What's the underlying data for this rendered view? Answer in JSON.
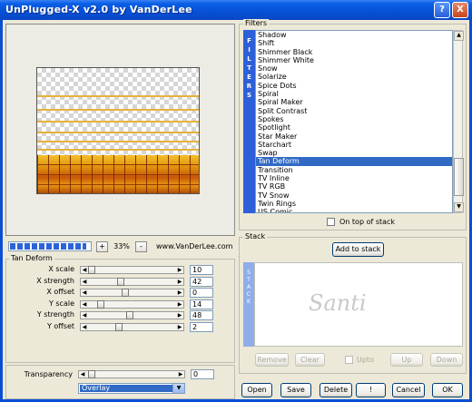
{
  "window": {
    "title": "UnPlugged-X v2.0 by VanDerLee",
    "help_label": "?",
    "close_label": "X"
  },
  "preview": {
    "zoom_value": "33%",
    "zoom_plus": "+",
    "zoom_minus": "-",
    "website": "www.VanDerLee.com",
    "progress_fraction": 0.95
  },
  "tan_deform": {
    "title": "Tan Deform",
    "sliders": [
      {
        "label": "X scale",
        "value": "10"
      },
      {
        "label": "X strength",
        "value": "42"
      },
      {
        "label": "X offset",
        "value": "0"
      },
      {
        "label": "Y scale",
        "value": "14"
      },
      {
        "label": "Y strength",
        "value": "48"
      },
      {
        "label": "Y offset",
        "value": "2"
      }
    ]
  },
  "transparency": {
    "label": "Transparency",
    "value": "0",
    "blend_mode": "Overlay"
  },
  "filters": {
    "title": "Filters",
    "strip_letters": [
      "F",
      "I",
      "L",
      "T",
      "E",
      "R",
      "S"
    ],
    "items": [
      "Shadow",
      "Shift",
      "Shimmer Black",
      "Shimmer White",
      "Snow",
      "Solarize",
      "Spice Dots",
      "Spiral",
      "Spiral Maker",
      "Split Contrast",
      "Spokes",
      "Spotlight",
      "Star Maker",
      "Starchart",
      "Swap",
      "Tan Deform",
      "Transition",
      "TV Inline",
      "TV RGB",
      "TV Snow",
      "Twin Rings",
      "US Comic"
    ],
    "selected_index": 15,
    "on_top_label": "On top of stack"
  },
  "stack": {
    "title": "Stack",
    "add_label": "Add to stack",
    "strip_letters": [
      "S",
      "T",
      "A",
      "C",
      "K"
    ],
    "watermark": "Santi",
    "remove_label": "Remove",
    "clear_label": "Clear",
    "upto_label": "Upto",
    "up_label": "Up",
    "down_label": "Down"
  },
  "footer": {
    "open_label": "Open",
    "save_label": "Save",
    "delete_label": "Delete",
    "q_label": "!",
    "cancel_label": "Cancel",
    "ok_label": "OK"
  },
  "colors": {
    "titlebar": "#0a5fe6",
    "selection": "#316ac5",
    "filters_strip": "#2c5fd8",
    "stack_strip": "#8faee9"
  }
}
